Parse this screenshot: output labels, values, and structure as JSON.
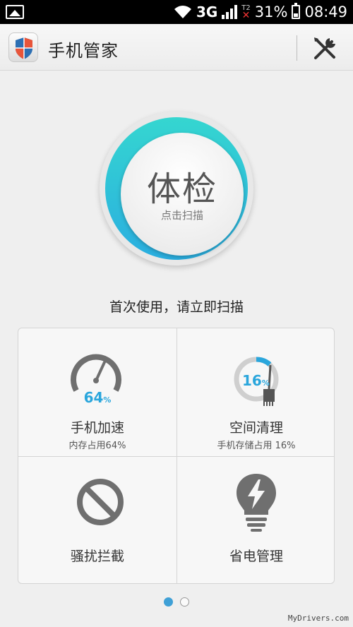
{
  "status_bar": {
    "network": "3G",
    "sim2_label": "T2",
    "battery": "31%",
    "time": "08:49"
  },
  "app_bar": {
    "title": "手机管家",
    "tools_icon": "tools-icon"
  },
  "scan": {
    "title": "体检",
    "subtitle": "点击扫描"
  },
  "prompt": "首次使用，请立即扫描",
  "tiles": [
    {
      "value": "64",
      "unit": "%",
      "name": "手机加速",
      "sub": "内存占用64%",
      "icon": "speedometer-icon"
    },
    {
      "value": "16",
      "unit": "%",
      "name": "空间清理",
      "sub": "手机存储占用 16%",
      "icon": "broom-icon"
    },
    {
      "name": "骚扰拦截",
      "icon": "block-icon"
    },
    {
      "name": "省电管理",
      "icon": "lightning-bulb-icon"
    }
  ],
  "pager": {
    "count": 2,
    "active": 0
  },
  "watermark": "MyDrivers.com",
  "colors": {
    "accent": "#2aaee0",
    "ring_top": "#35d6d0",
    "status_bg": "#000000",
    "page_bg": "#efefef"
  }
}
